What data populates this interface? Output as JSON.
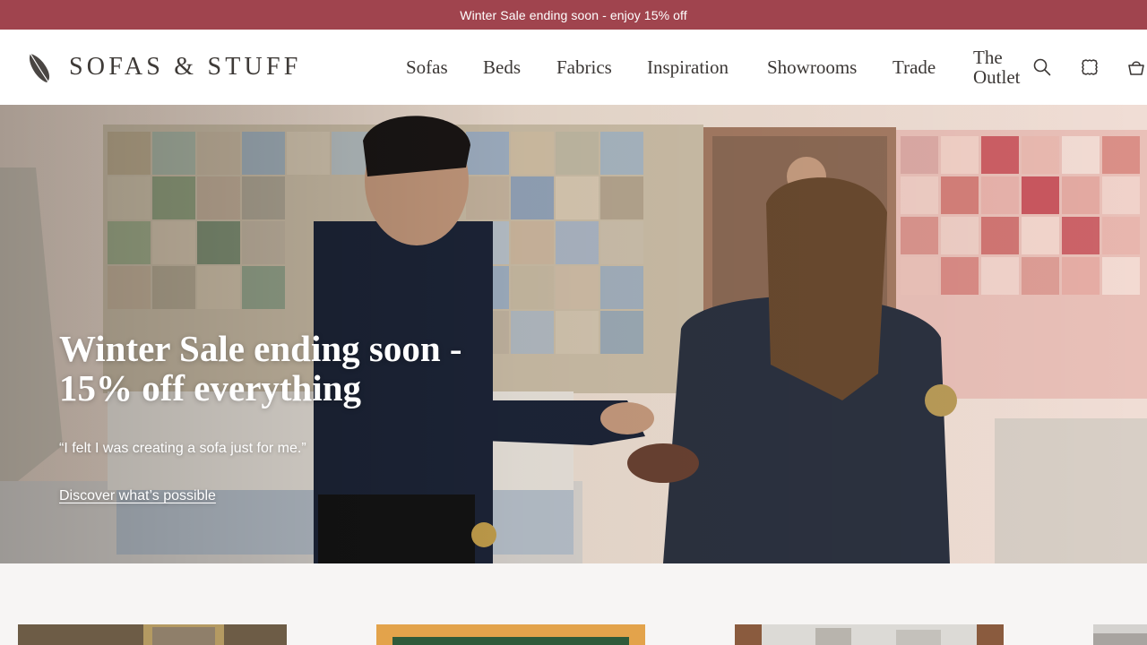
{
  "announcement": {
    "text": "Winter Sale ending soon - enjoy 15% off"
  },
  "brand": {
    "name": "SOFAS & STUFF",
    "logo_icon": "feather-icon"
  },
  "nav": {
    "items": [
      {
        "label": "Sofas"
      },
      {
        "label": "Beds"
      },
      {
        "label": "Fabrics"
      },
      {
        "label": "Inspiration"
      },
      {
        "label": "Showrooms"
      },
      {
        "label": "Trade"
      },
      {
        "label_line1": "The",
        "label_line2": "Outlet"
      }
    ],
    "icons": [
      "search-icon",
      "fabric-swatch-icon",
      "basket-icon"
    ]
  },
  "hero": {
    "title": "Winter Sale ending soon - 15% off everything",
    "quote": "“I felt I was creating a sofa just for me.”",
    "link": "Discover what’s possible"
  },
  "colors": {
    "announcement_bg": "#a0444e",
    "header_bg": "#ffffff",
    "page_bg": "#f7f5f4",
    "text_dark": "#3b3735"
  }
}
